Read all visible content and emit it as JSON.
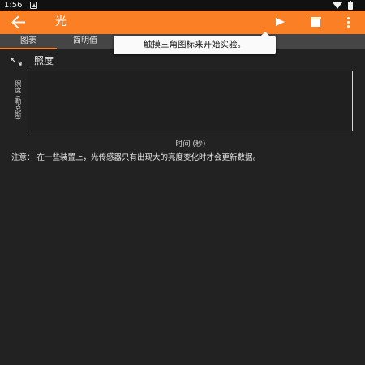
{
  "status_bar": {
    "time": "1:56"
  },
  "toolbar": {
    "title": "光"
  },
  "tabs": [
    {
      "label": "图表"
    },
    {
      "label": "简明值"
    }
  ],
  "tooltip": {
    "text": "触摸三角图标来开始实验。"
  },
  "chart_data": {
    "type": "line",
    "title": "照度",
    "xlabel": "时间 (秒)",
    "ylabel": "照度 (勒克斯)",
    "series": [],
    "x": [],
    "grid": false
  },
  "note": "注意：  在一些装置上，光传感器只有出现大的亮度变化时才会更新数据。",
  "colors": {
    "accent": "#fb7f24",
    "background": "#222222",
    "tab_bar": "#454545"
  }
}
